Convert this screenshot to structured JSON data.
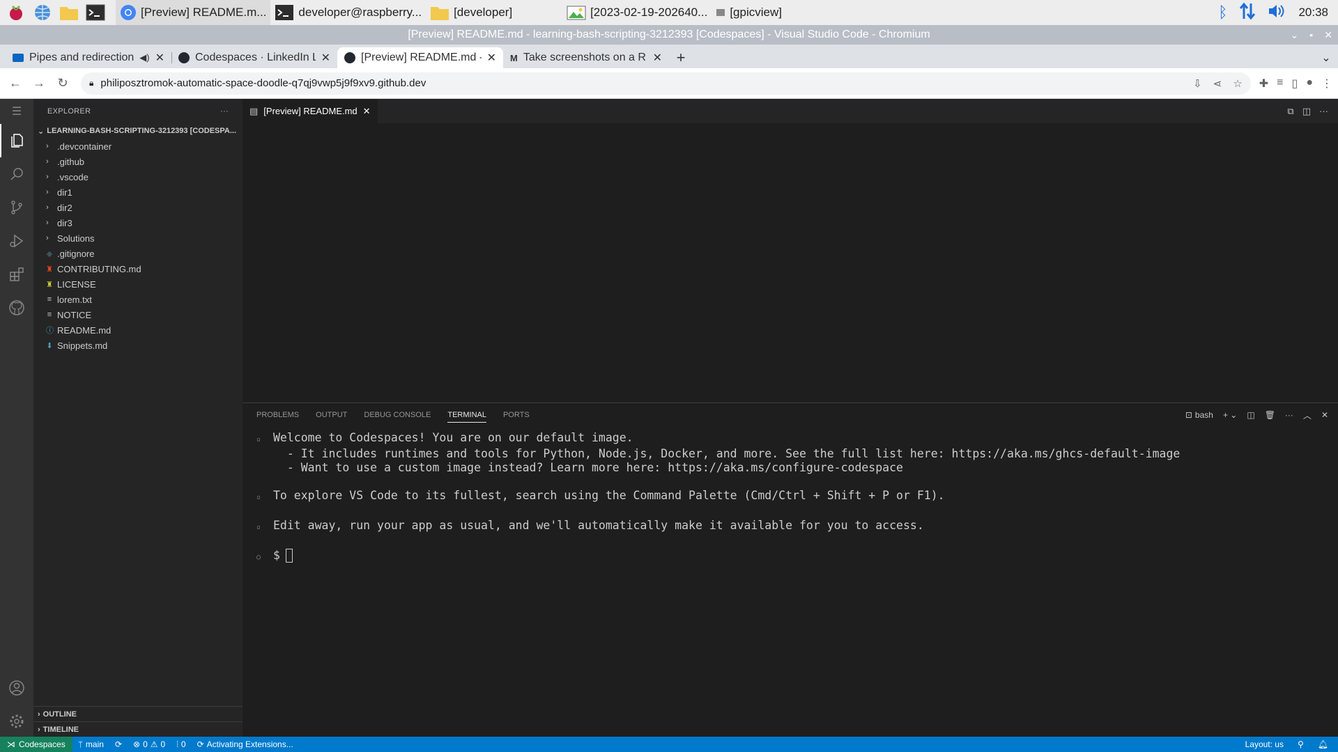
{
  "taskbar": {
    "tasks": [
      {
        "label": "[Preview] README.m..."
      },
      {
        "label": "developer@raspberry..."
      },
      {
        "label": "[developer]"
      },
      {
        "label": "[2023-02-19-202640..."
      },
      {
        "label": "[gpicview]"
      }
    ],
    "clock": "20:38"
  },
  "window": {
    "title": "[Preview] README.md - learning-bash-scripting-3212393 [Codespaces] - Visual Studio Code - Chromium"
  },
  "browser": {
    "tabs": [
      {
        "label": "Pipes and redirection"
      },
      {
        "label": "Codespaces · LinkedIn Le"
      },
      {
        "label": "[Preview] README.md - l"
      },
      {
        "label": "Take screenshots on a R"
      }
    ],
    "url": "philiposztromok-automatic-space-doodle-q7qj9vwp5j9f9xv9.github.dev"
  },
  "explorer": {
    "header": "EXPLORER",
    "root": "LEARNING-BASH-SCRIPTING-3212393 [CODESPA...",
    "items": [
      {
        "label": ".devcontainer",
        "type": "folder"
      },
      {
        "label": ".github",
        "type": "folder"
      },
      {
        "label": ".vscode",
        "type": "folder"
      },
      {
        "label": "dir1",
        "type": "folder"
      },
      {
        "label": "dir2",
        "type": "folder"
      },
      {
        "label": "dir3",
        "type": "folder"
      },
      {
        "label": "Solutions",
        "type": "folder"
      },
      {
        "label": ".gitignore",
        "type": "file",
        "icon": "◆",
        "color": "#41535b"
      },
      {
        "label": "CONTRIBUTING.md",
        "type": "file",
        "icon": "♜",
        "color": "#e64a19"
      },
      {
        "label": "LICENSE",
        "type": "file",
        "icon": "♜",
        "color": "#cbcb41"
      },
      {
        "label": "lorem.txt",
        "type": "file",
        "icon": "≡",
        "color": "#c5c5c5"
      },
      {
        "label": "NOTICE",
        "type": "file",
        "icon": "≡",
        "color": "#c5c5c5"
      },
      {
        "label": "README.md",
        "type": "file",
        "icon": "ⓘ",
        "color": "#519aba"
      },
      {
        "label": "Snippets.md",
        "type": "file",
        "icon": "⬇",
        "color": "#519aba"
      }
    ],
    "outline": "OUTLINE",
    "timeline": "TIMELINE"
  },
  "editor": {
    "tab": "[Preview] README.md"
  },
  "panel": {
    "tabs": [
      "PROBLEMS",
      "OUTPUT",
      "DEBUG CONSOLE",
      "TERMINAL",
      "PORTS"
    ],
    "active_tab": "TERMINAL",
    "shell": "bash",
    "terminal_lines": [
      {
        "mark": "▫",
        "text": "Welcome to Codespaces! You are on our default image."
      },
      {
        "mark": "",
        "text": "  - It includes runtimes and tools for Python, Node.js, Docker, and more. See the full list here: https://aka.ms/ghcs-default-image"
      },
      {
        "mark": "",
        "text": "  - Want to use a custom image instead? Learn more here: https://aka.ms/configure-codespace"
      },
      {
        "mark": "",
        "text": ""
      },
      {
        "mark": "▫",
        "text": "To explore VS Code to its fullest, search using the Command Palette (Cmd/Ctrl + Shift + P or F1)."
      },
      {
        "mark": "",
        "text": ""
      },
      {
        "mark": "▫",
        "text": "Edit away, run your app as usual, and we'll automatically make it available for you to access."
      },
      {
        "mark": "",
        "text": ""
      }
    ],
    "prompt": "$"
  },
  "status": {
    "remote": "Codespaces",
    "branch": "main",
    "errors": "0",
    "warnings": "0",
    "ports": "0",
    "activity": "Activating Extensions...",
    "layout": "Layout: us"
  }
}
